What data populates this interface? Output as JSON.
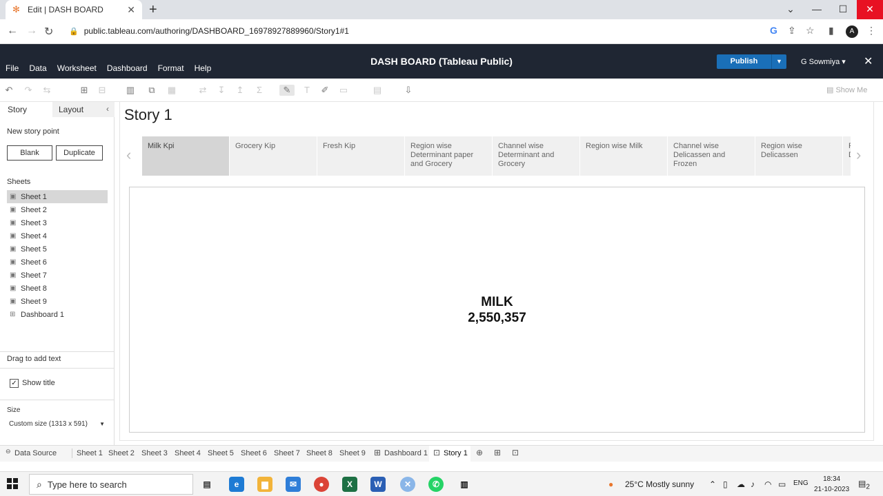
{
  "browser": {
    "tab_title": "Edit | DASH BOARD",
    "tab_icon": "tableau-icon",
    "url": "public.tableau.com/authoring/DASHBOARD_16978927889960/Story1#1"
  },
  "app": {
    "title": "DASH BOARD (Tableau Public)",
    "menu": [
      "File",
      "Data",
      "Worksheet",
      "Dashboard",
      "Format",
      "Help"
    ],
    "publish_label": "Publish",
    "user": "G Sowmiya ▾",
    "accent_color": "#1a6fb8",
    "header_color": "#1f2633"
  },
  "toolbar": {
    "show_me_label": "Show Me"
  },
  "left_pane": {
    "tabs": [
      "Story",
      "Layout"
    ],
    "new_story_point_label": "New story point",
    "blank_label": "Blank",
    "duplicate_label": "Duplicate",
    "sheets_title": "Sheets",
    "sheets": [
      "Sheet 1",
      "Sheet 2",
      "Sheet 3",
      "Sheet 4",
      "Sheet 5",
      "Sheet 6",
      "Sheet 7",
      "Sheet 8",
      "Sheet 9",
      "Dashboard 1"
    ],
    "drag_text_label": "Drag to add text",
    "show_title_label": "Show title",
    "size_title": "Size",
    "size_value": "Custom size (1313 x 591)"
  },
  "story": {
    "title": "Story 1",
    "points": [
      "Milk Kpi",
      "Grocery Kip",
      "Fresh Kip",
      "Region wise Determinant paper and Grocery",
      "Channel wise Determinant  and Grocery",
      "Region wise Milk",
      "Channel wise Delicassen and Frozen",
      "Region wise Delicassen",
      "R D D"
    ],
    "kpi_label": "MILK",
    "kpi_value": "2,550,357"
  },
  "sheet_tabs": {
    "data_source": "Data Source",
    "tabs": [
      "Sheet 1",
      "Sheet 2",
      "Sheet 3",
      "Sheet 4",
      "Sheet 5",
      "Sheet 6",
      "Sheet 7",
      "Sheet 8",
      "Sheet 9",
      "Dashboard 1",
      "Story 1"
    ]
  },
  "taskbar": {
    "search_placeholder": "Type here to search",
    "weather": "25°C  Mostly sunny",
    "lang": "ENG",
    "time": "18:34",
    "date": "21-10-2023",
    "notification_count": "2"
  }
}
